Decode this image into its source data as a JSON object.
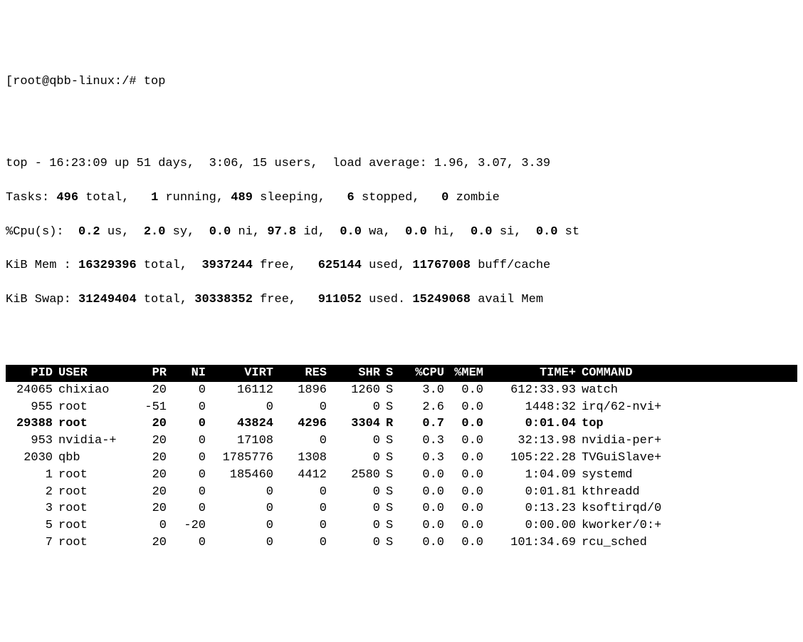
{
  "prompt_prefix": "[root@qbb-linux:/# ",
  "prompt_cmd": "top",
  "summary": {
    "line1": "top - 16:23:09 up 51 days,  3:06, 15 users,  load average: 1.96, 3.07, 3.39",
    "l2": {
      "a": "Tasks: ",
      "b": "496 ",
      "c": "total,   ",
      "d": "1 ",
      "e": "running, ",
      "f": "489 ",
      "g": "sleeping,   ",
      "h": "6 ",
      "i": "stopped,   ",
      "j": "0 ",
      "k": "zombie"
    },
    "l3": {
      "a": "%Cpu(s):  ",
      "b": "0.2 ",
      "c": "us,  ",
      "d": "2.0 ",
      "e": "sy,  ",
      "f": "0.0 ",
      "g": "ni, ",
      "h": "97.8 ",
      "i": "id,  ",
      "j": "0.0 ",
      "k": "wa,  ",
      "l": "0.0 ",
      "m": "hi,  ",
      "n": "0.0 ",
      "o": "si,  ",
      "p": "0.0 ",
      "q": "st"
    },
    "l4": {
      "a": "KiB Mem : ",
      "b": "16329396 ",
      "c": "total,  ",
      "d": "3937244 ",
      "e": "free,   ",
      "f": "625144 ",
      "g": "used, ",
      "h": "11767008 ",
      "i": "buff/cache"
    },
    "l5": {
      "a": "KiB Swap: ",
      "b": "31249404 ",
      "c": "total, ",
      "d": "30338352 ",
      "e": "free,   ",
      "f": "911052 ",
      "g": "used. ",
      "h": "15249068 ",
      "i": "avail Mem"
    }
  },
  "headers": [
    "PID",
    "USER",
    "PR",
    "NI",
    "VIRT",
    "RES",
    "SHR",
    "S",
    "%CPU",
    "%MEM",
    "TIME+",
    "COMMAND"
  ],
  "rows": [
    {
      "pid": "24065",
      "user": "chixiao",
      "pr": "20",
      "ni": "0",
      "virt": "16112",
      "res": "1896",
      "shr": "1260",
      "s": "S",
      "cpu": "3.0",
      "mem": "0.0",
      "time": "612:33.93",
      "cmd": "watch",
      "hl": false
    },
    {
      "pid": "955",
      "user": "root",
      "pr": "-51",
      "ni": "0",
      "virt": "0",
      "res": "0",
      "shr": "0",
      "s": "S",
      "cpu": "2.6",
      "mem": "0.0",
      "time": "1448:32",
      "cmd": "irq/62-nvi+",
      "hl": false
    },
    {
      "pid": "29388",
      "user": "root",
      "pr": "20",
      "ni": "0",
      "virt": "43824",
      "res": "4296",
      "shr": "3304",
      "s": "R",
      "cpu": "0.7",
      "mem": "0.0",
      "time": "0:01.04",
      "cmd": "top",
      "hl": true
    },
    {
      "pid": "953",
      "user": "nvidia-+",
      "pr": "20",
      "ni": "0",
      "virt": "17108",
      "res": "0",
      "shr": "0",
      "s": "S",
      "cpu": "0.3",
      "mem": "0.0",
      "time": "32:13.98",
      "cmd": "nvidia-per+",
      "hl": false
    },
    {
      "pid": "2030",
      "user": "qbb",
      "pr": "20",
      "ni": "0",
      "virt": "1785776",
      "res": "1308",
      "shr": "0",
      "s": "S",
      "cpu": "0.3",
      "mem": "0.0",
      "time": "105:22.28",
      "cmd": "TVGuiSlave+",
      "hl": false
    },
    {
      "pid": "1",
      "user": "root",
      "pr": "20",
      "ni": "0",
      "virt": "185460",
      "res": "4412",
      "shr": "2580",
      "s": "S",
      "cpu": "0.0",
      "mem": "0.0",
      "time": "1:04.09",
      "cmd": "systemd",
      "hl": false
    },
    {
      "pid": "2",
      "user": "root",
      "pr": "20",
      "ni": "0",
      "virt": "0",
      "res": "0",
      "shr": "0",
      "s": "S",
      "cpu": "0.0",
      "mem": "0.0",
      "time": "0:01.81",
      "cmd": "kthreadd",
      "hl": false
    },
    {
      "pid": "3",
      "user": "root",
      "pr": "20",
      "ni": "0",
      "virt": "0",
      "res": "0",
      "shr": "0",
      "s": "S",
      "cpu": "0.0",
      "mem": "0.0",
      "time": "0:13.23",
      "cmd": "ksoftirqd/0",
      "hl": false
    },
    {
      "pid": "5",
      "user": "root",
      "pr": "0",
      "ni": "-20",
      "virt": "0",
      "res": "0",
      "shr": "0",
      "s": "S",
      "cpu": "0.0",
      "mem": "0.0",
      "time": "0:00.00",
      "cmd": "kworker/0:+",
      "hl": false
    },
    {
      "pid": "7",
      "user": "root",
      "pr": "20",
      "ni": "0",
      "virt": "0",
      "res": "0",
      "shr": "0",
      "s": "S",
      "cpu": "0.0",
      "mem": "0.0",
      "time": "101:34.69",
      "cmd": "rcu_sched",
      "hl": false
    }
  ]
}
